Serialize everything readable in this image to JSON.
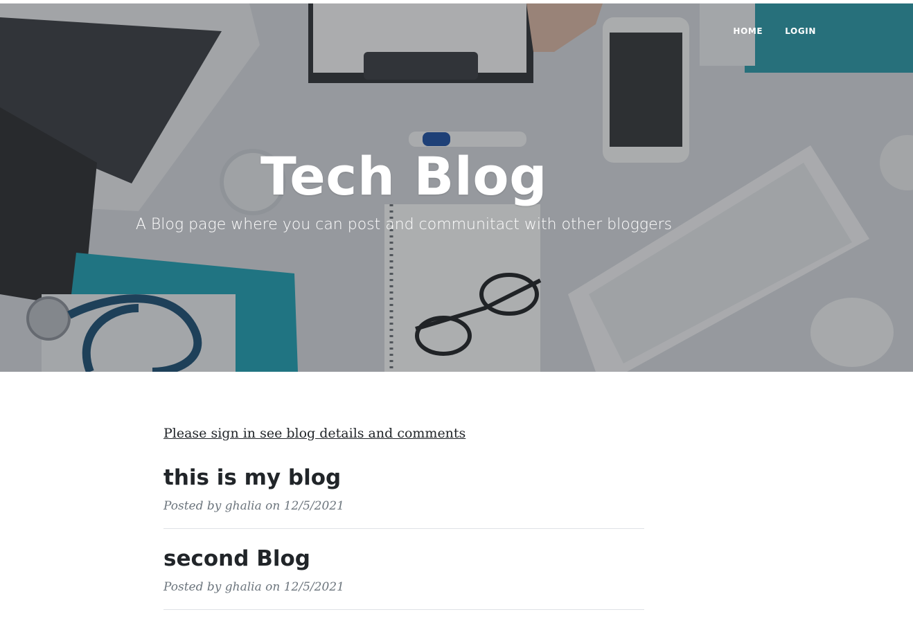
{
  "nav": {
    "items": [
      {
        "label": "HOME"
      },
      {
        "label": "LOGIN"
      }
    ]
  },
  "hero": {
    "title": "Tech Blog",
    "subtitle": "A Blog page where you can post and communitact with other bloggers"
  },
  "main": {
    "signin_notice": "Please sign in see blog details and comments",
    "posts": [
      {
        "title": "this is my blog",
        "meta": "Posted by ghalia on 12/5/2021"
      },
      {
        "title": "second Blog",
        "meta": "Posted by ghalia on 12/5/2021"
      }
    ]
  },
  "colors": {
    "text": "#212529",
    "meta": "#6c757d",
    "divider": "#dee2e6",
    "hero_overlay": "#212529",
    "accent_teal": "#1f9fb3"
  }
}
